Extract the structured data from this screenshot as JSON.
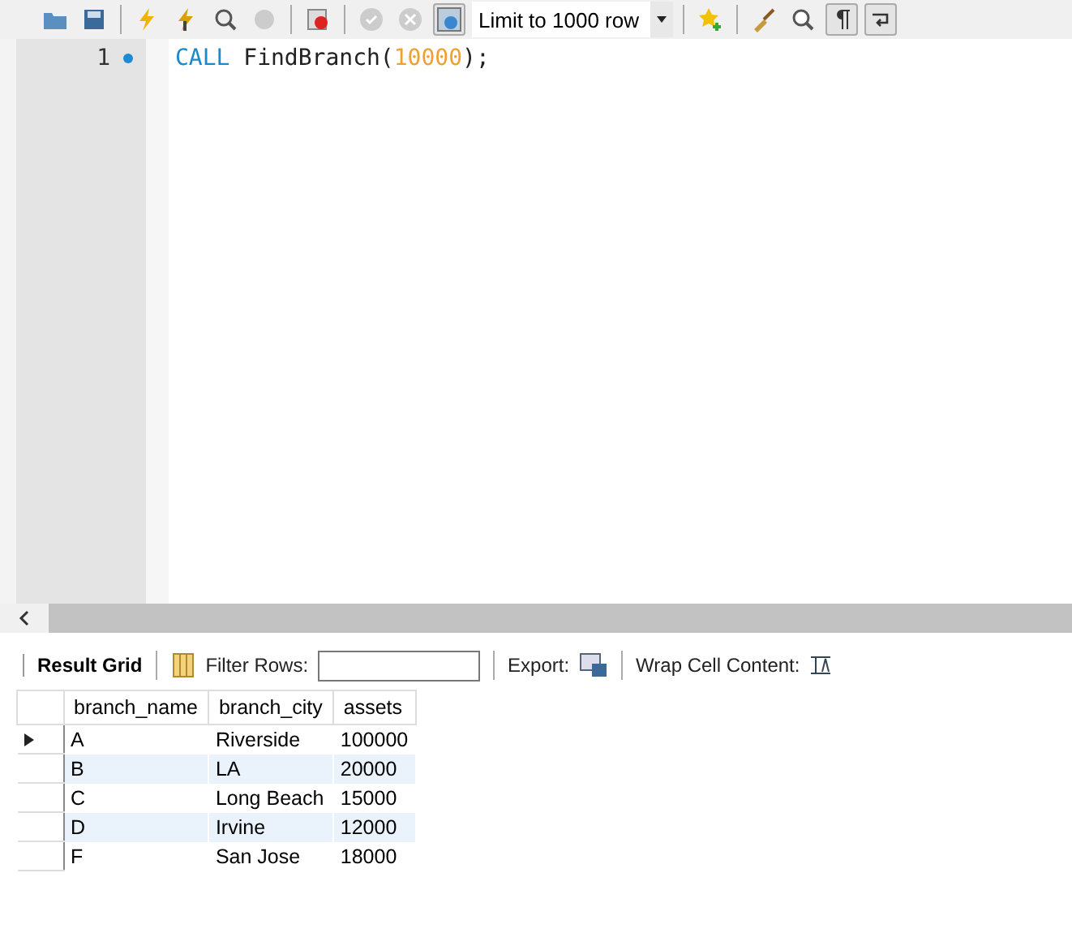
{
  "toolbar": {
    "limit_select": {
      "value": "Limit to 1000 row"
    }
  },
  "editor": {
    "lines": [
      {
        "number": "1",
        "marked": true,
        "tokens": [
          {
            "kind": "keyword",
            "text": "CALL"
          },
          {
            "kind": "plain",
            "text": " FindBranch("
          },
          {
            "kind": "number",
            "text": "10000"
          },
          {
            "kind": "plain",
            "text": ");"
          }
        ]
      }
    ]
  },
  "result_toolbar": {
    "tab": "Result Grid",
    "filter_label": "Filter Rows:",
    "export_label": "Export:",
    "wrap_label": "Wrap Cell Content:"
  },
  "table": {
    "columns": [
      "branch_name",
      "branch_city",
      "assets"
    ],
    "rows": [
      {
        "selected": true,
        "cells": [
          "A",
          "Riverside",
          "100000"
        ]
      },
      {
        "selected": false,
        "cells": [
          "B",
          "LA",
          "20000"
        ]
      },
      {
        "selected": false,
        "cells": [
          "C",
          "Long Beach",
          "15000"
        ]
      },
      {
        "selected": false,
        "cells": [
          "D",
          "Irvine",
          "12000"
        ]
      },
      {
        "selected": false,
        "cells": [
          "F",
          "San Jose",
          "18000"
        ]
      }
    ]
  }
}
